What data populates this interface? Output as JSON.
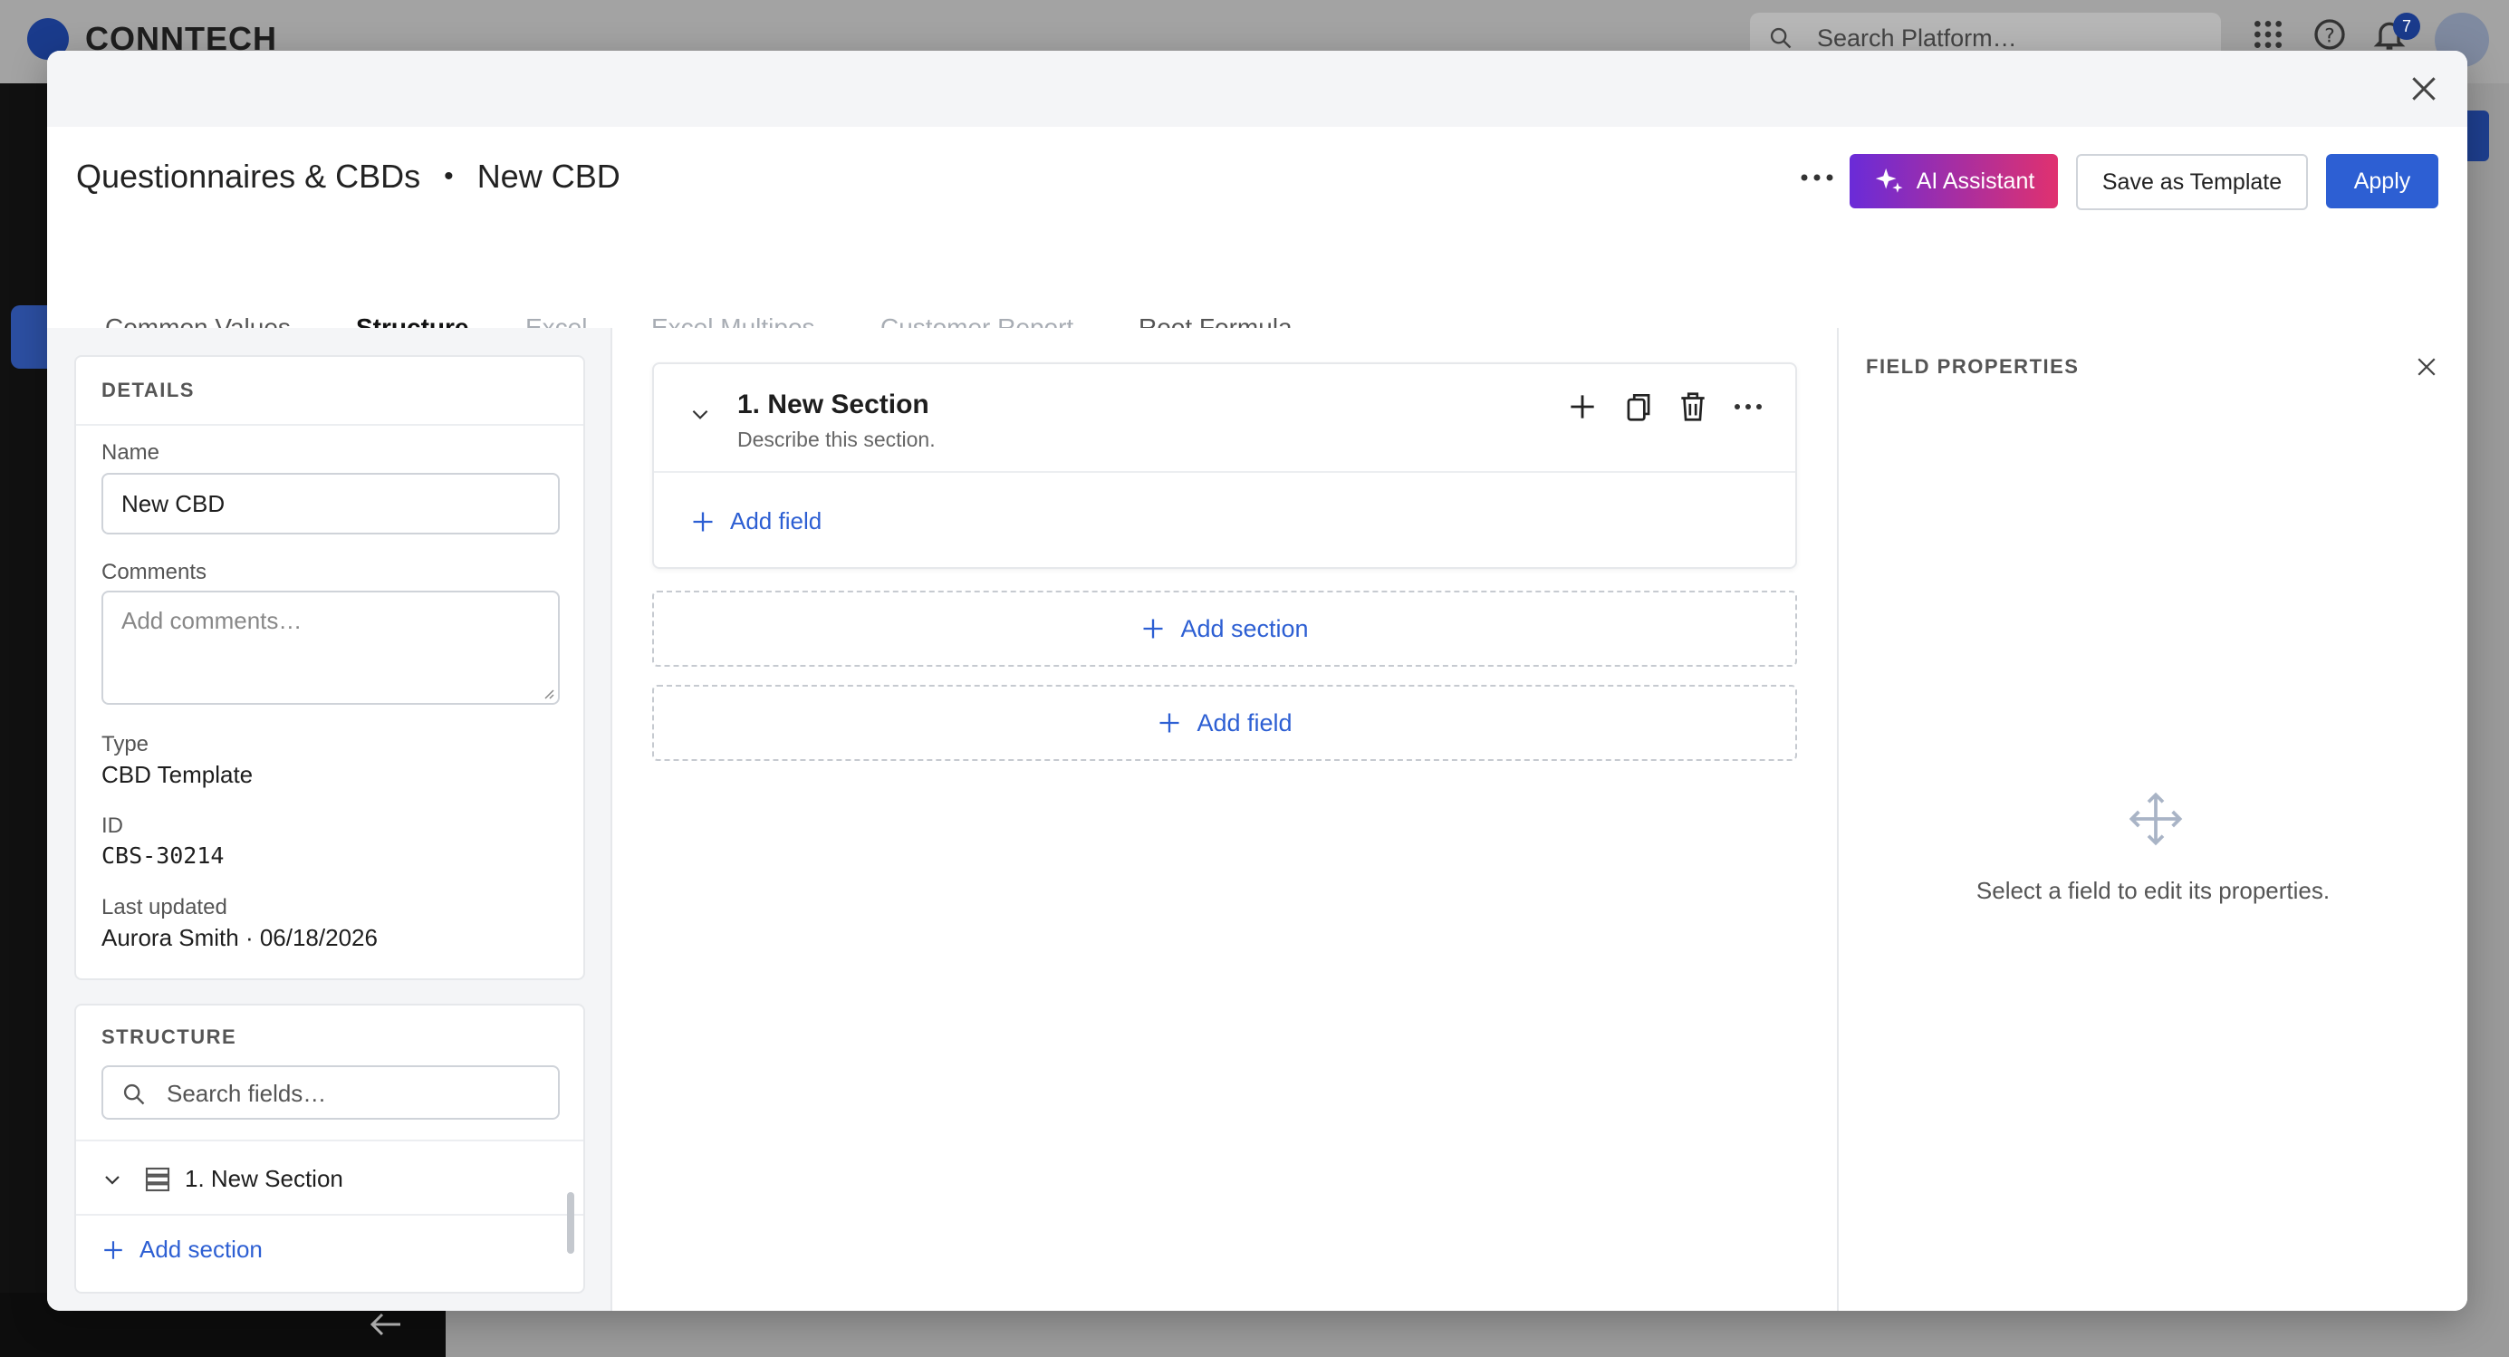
{
  "background_app": {
    "brand": "CONNTECH",
    "search_placeholder": "Search Platform…",
    "notification_count": "7"
  },
  "modal": {
    "breadcrumb": {
      "parent": "Questionnaires & CBDs",
      "separator": "•",
      "current": "New CBD"
    },
    "actions": {
      "ai_assistant": "AI Assistant",
      "save_template": "Save as Template",
      "apply": "Apply"
    },
    "tabs": [
      {
        "label": "Common Values",
        "state": "normal"
      },
      {
        "label": "Structure",
        "state": "active"
      },
      {
        "label": "Excel",
        "state": "disabled"
      },
      {
        "label": "Excel Multipos",
        "state": "disabled"
      },
      {
        "label": "Customer Report",
        "state": "disabled"
      },
      {
        "label": "Root Formula",
        "state": "normal"
      }
    ]
  },
  "details": {
    "title": "DETAILS",
    "name_label": "Name",
    "name_value": "New CBD",
    "comments_label": "Comments",
    "comments_placeholder": "Add comments…",
    "type_label": "Type",
    "type_value": "CBD Template",
    "id_label": "ID",
    "id_value": "CBS-30214",
    "updated_label": "Last updated",
    "updated_value": "Aurora Smith · 06/18/2026"
  },
  "structure": {
    "title": "STRUCTURE",
    "search_placeholder": "Search fields…",
    "tree_item": "1. New Section",
    "add_section": "Add section"
  },
  "editor": {
    "section_title": "1. New Section",
    "section_desc": "Describe this section.",
    "add_field_inner": "Add field",
    "add_section": "Add section",
    "add_field": "Add field"
  },
  "field_properties": {
    "title": "FIELD PROPERTIES",
    "empty_text": "Select a field to edit its properties."
  },
  "colors": {
    "primary": "#2d5fd3",
    "ai_gradient_start": "#6a2bd8",
    "ai_gradient_end": "#e0316f"
  }
}
